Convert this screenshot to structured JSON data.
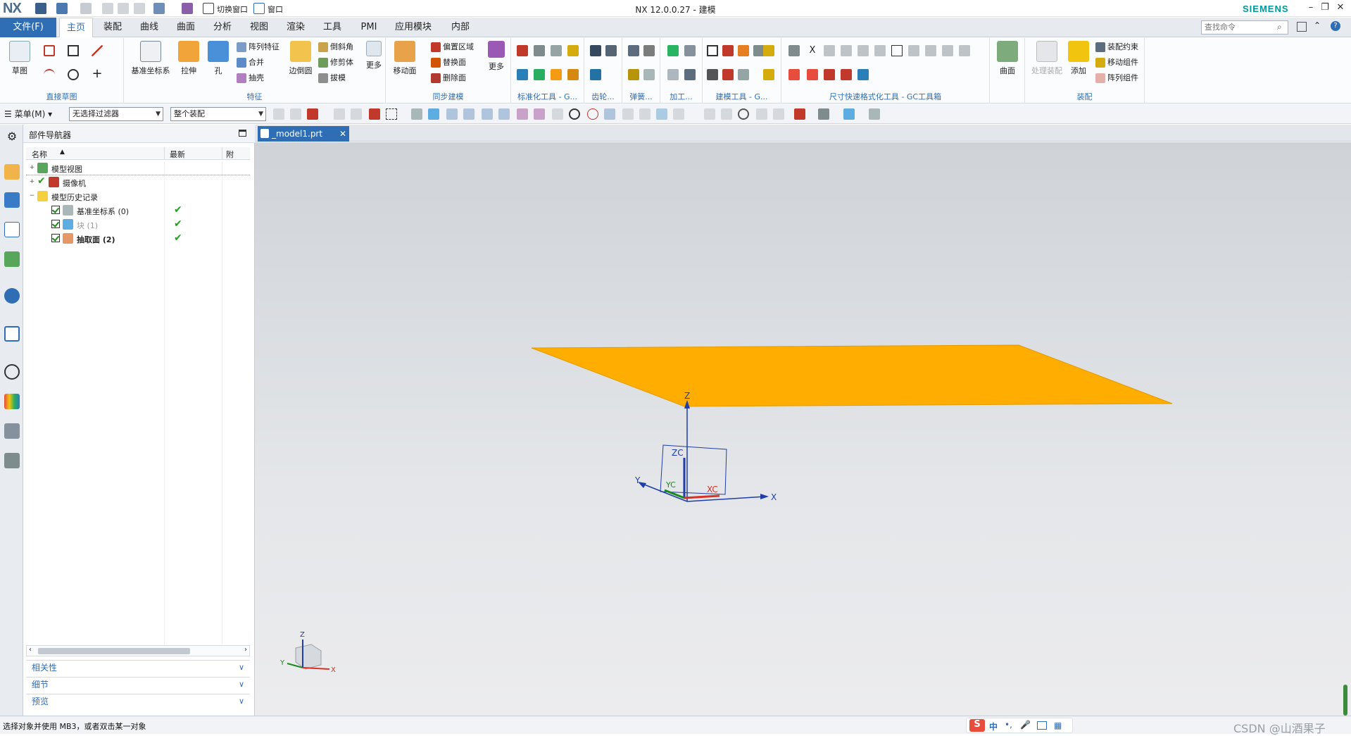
{
  "titlebar": {
    "logo": "NX",
    "title": "NX 12.0.0.27 - 建模",
    "brand": "SIEMENS",
    "switch_window": "切换窗口",
    "window_menu": "窗口"
  },
  "ribbon_tabs": {
    "file": "文件(F)",
    "tabs": [
      "主页",
      "装配",
      "曲线",
      "曲面",
      "分析",
      "视图",
      "渲染",
      "工具",
      "PMI",
      "应用模块",
      "内部"
    ],
    "search_placeholder": "查找命令"
  },
  "ribbon": {
    "direct_sketch": {
      "label": "直接草图",
      "sketch": "草图"
    },
    "feature": {
      "label": "特征",
      "datum_csys": "基准坐标系",
      "extrude": "拉伸",
      "hole": "孔",
      "pattern_feature": "阵列特征",
      "unite": "合并",
      "shell": "抽壳",
      "edge_blend": "边倒圆",
      "chamfer": "倒斜角",
      "trim_body": "修剪体",
      "draft": "拔模",
      "more": "更多"
    },
    "sync_modeling": {
      "label": "同步建模",
      "move_face": "移动面",
      "offset_region": "偏置区域",
      "replace_face": "替换面",
      "delete_face": "删除面",
      "more": "更多"
    },
    "std_tools": {
      "label": "标准化工具 - G..."
    },
    "gear": {
      "label": "齿轮..."
    },
    "spring": {
      "label": "弹簧..."
    },
    "machining": {
      "label": "加工..."
    },
    "modeling_tools": {
      "label": "建模工具 - G..."
    },
    "dim_tools": {
      "label": "尺寸快速格式化工具 - GC工具箱"
    },
    "surface": {
      "label": "曲面"
    },
    "assembly": {
      "label": "装配",
      "process_assembly": "处理装配",
      "add": "添加",
      "assembly_constraint": "装配约束",
      "move_component": "移动组件",
      "pattern_component": "阵列组件"
    }
  },
  "selection_bar": {
    "menu": "菜单(M)",
    "filter": "无选择过滤器",
    "scope": "整个装配"
  },
  "navigator": {
    "title": "部件导航器",
    "columns": [
      "名称",
      "最新",
      "附"
    ],
    "rows": [
      {
        "label": "模型视图"
      },
      {
        "label": "摄像机"
      },
      {
        "label": "模型历史记录"
      },
      {
        "label": "基准坐标系 (0)"
      },
      {
        "label": "块 (1)"
      },
      {
        "label": "抽取面 (2)"
      }
    ],
    "panels": [
      "相关性",
      "细节",
      "预览"
    ]
  },
  "document_tab": {
    "name": "_model1.prt"
  },
  "viewport": {
    "axis_labels": {
      "z": "Z",
      "x": "X",
      "y": "Y",
      "zc": "ZC",
      "xc": "XC",
      "yc": "YC"
    },
    "face_color": "#ffad00"
  },
  "status": {
    "text": "选择对象并使用 MB3，或者双击某一对象",
    "ime_label": "中",
    "watermark": "CSDN @山酒果子"
  }
}
